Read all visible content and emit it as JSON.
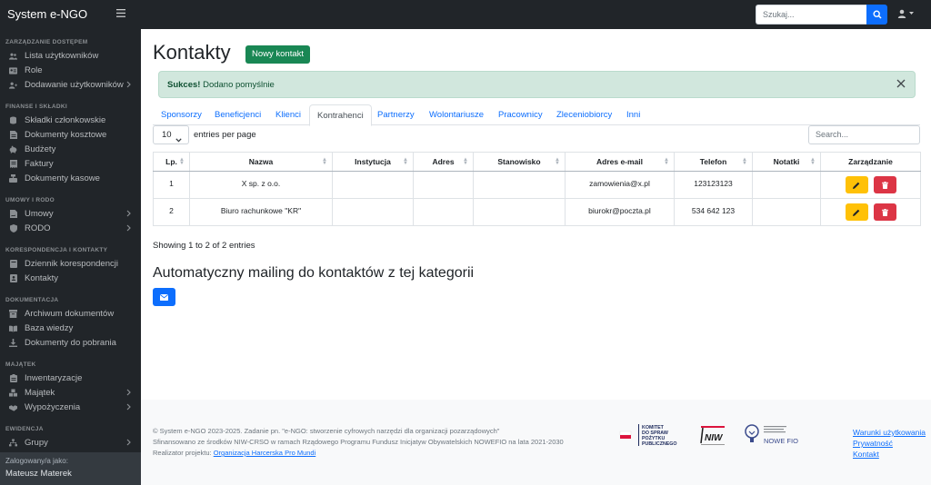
{
  "app": {
    "brand": "System e-NGO"
  },
  "topbar": {
    "search_placeholder": "Szukaj..."
  },
  "sidebar": {
    "sections": [
      {
        "heading": "ZARZĄDZANIE DOSTĘPEM",
        "items": [
          {
            "label": "Lista użytkowników",
            "icon": "users-icon",
            "chevron": false
          },
          {
            "label": "Role",
            "icon": "id-card-icon",
            "chevron": false
          },
          {
            "label": "Dodawanie użytkowników",
            "icon": "user-plus-icon",
            "chevron": true
          }
        ]
      },
      {
        "heading": "FINANSE I SKŁADKI",
        "items": [
          {
            "label": "Składki członkowskie",
            "icon": "coins-icon",
            "chevron": false
          },
          {
            "label": "Dokumenty kosztowe",
            "icon": "file-invoice-icon",
            "chevron": false
          },
          {
            "label": "Budżety",
            "icon": "piggy-bank-icon",
            "chevron": false
          },
          {
            "label": "Faktury",
            "icon": "receipt-icon",
            "chevron": false
          },
          {
            "label": "Dokumenty kasowe",
            "icon": "cash-register-icon",
            "chevron": false
          }
        ]
      },
      {
        "heading": "UMOWY I RODO",
        "items": [
          {
            "label": "Umowy",
            "icon": "contract-icon",
            "chevron": true
          },
          {
            "label": "RODO",
            "icon": "shield-icon",
            "chevron": true
          }
        ]
      },
      {
        "heading": "KORESPONDENCJA I KONTAKTY",
        "items": [
          {
            "label": "Dziennik korespondencji",
            "icon": "book-icon",
            "chevron": false
          },
          {
            "label": "Kontakty",
            "icon": "address-book-icon",
            "chevron": false
          }
        ]
      },
      {
        "heading": "DOKUMENTACJA",
        "items": [
          {
            "label": "Archiwum dokumentów",
            "icon": "archive-icon",
            "chevron": false
          },
          {
            "label": "Baza wiedzy",
            "icon": "book-open-icon",
            "chevron": false
          },
          {
            "label": "Dokumenty do pobrania",
            "icon": "download-icon",
            "chevron": false
          }
        ]
      },
      {
        "heading": "MAJĄTEK",
        "items": [
          {
            "label": "Inwentaryzacje",
            "icon": "clipboard-list-icon",
            "chevron": false
          },
          {
            "label": "Majątek",
            "icon": "boxes-icon",
            "chevron": true
          },
          {
            "label": "Wypożyczenia",
            "icon": "handshake-icon",
            "chevron": true
          }
        ]
      },
      {
        "heading": "EWIDENCJA",
        "items": [
          {
            "label": "Grupy",
            "icon": "sitemap-icon",
            "chevron": true
          }
        ]
      }
    ],
    "footer": {
      "label": "Zalogowany/a jako:",
      "user": "Mateusz Materek"
    }
  },
  "main": {
    "title": "Kontakty",
    "new_button": "Nowy kontakt",
    "alert": {
      "strong": "Sukces!",
      "text": "Dodano pomyślnie"
    },
    "tabs": [
      "Sponsorzy",
      "Beneficjenci",
      "Klienci",
      "Kontrahenci",
      "Partnerzy",
      "Wolontariusze",
      "Pracownicy",
      "Zleceniobiorcy",
      "Inni"
    ],
    "active_tab": "Kontrahenci",
    "per_page": {
      "value": "10",
      "label": "entries per page"
    },
    "table_search_placeholder": "Search...",
    "columns": [
      "Lp.",
      "Nazwa",
      "Instytucja",
      "Adres",
      "Stanowisko",
      "Adres e-mail",
      "Telefon",
      "Notatki",
      "Zarządzanie"
    ],
    "rows": [
      {
        "lp": "1",
        "nazwa": "X sp. z o.o.",
        "instytucja": "",
        "adres": "",
        "stanowisko": "",
        "email": "zamowienia@x.pl",
        "telefon": "123123123",
        "notatki": ""
      },
      {
        "lp": "2",
        "nazwa": "Biuro rachunkowe \"KR\"",
        "instytucja": "",
        "adres": "",
        "stanowisko": "",
        "email": "biurokr@poczta.pl",
        "telefon": "534 642 123",
        "notatki": ""
      }
    ],
    "showing": "Showing 1 to 2 of 2 entries",
    "mailing_title": "Automatyczny mailing do kontaktów z tej kategorii"
  },
  "footer": {
    "line1": "© System e-NGO 2023-2025. Zadanie pn. \"e-NGO: stworzenie cyfrowych narzędzi dla organizacji pozarządowych\"",
    "line2": "Sfinansowano ze środków NIW-CRSO w ramach Rządowego Programu Fundusz Inicjatyw Obywatelskich NOWEFIO na lata 2021-2030",
    "line3_prefix": "Realizator projektu: ",
    "line3_link": "Organizacja Harcerska Pro Mundi",
    "links": [
      "Warunki użytkowania",
      "Prywatność",
      "Kontakt"
    ],
    "logos": {
      "komitet": "KOMITET DO SPRAW POŻYTKU PUBLICZNEGO",
      "niw": "NIW",
      "fio": "NOWE FIO"
    }
  },
  "colors": {
    "primary": "#0d6efd",
    "success": "#198754",
    "warning": "#ffc107",
    "danger": "#dc3545",
    "dark": "#212529"
  }
}
